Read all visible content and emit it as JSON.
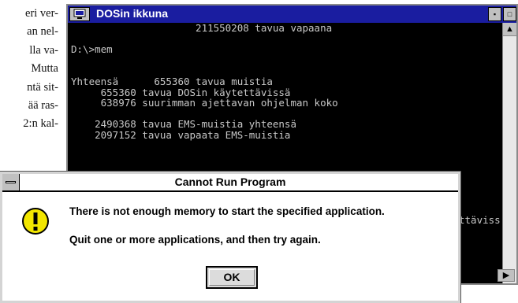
{
  "background_text": {
    "lines": [
      "eri ver-",
      "an nel-",
      "lla va-",
      "Mutta",
      "ntä sit-",
      "ää ras-",
      "2:n kal-"
    ]
  },
  "dos_window": {
    "title": "DOSin ikkuna",
    "console_lines": [
      "                     211550208 tavua vapaana",
      "",
      "D:\\>mem",
      "",
      "",
      "Yhteensä      655360 tavua muistia",
      "     655360 tavua DOSin käytettävissä",
      "     638976 suurimman ajettavan ohjelman koko",
      "",
      "    2490368 tavua EMS-muistia yhteensä",
      "    2097152 tavua vapaata EMS-muistia"
    ],
    "partial_right_text": "ttäviss"
  },
  "dialog": {
    "title": "Cannot Run Program",
    "message_line1": "There is not enough memory to start the specified application.",
    "message_line2": "Quit one or more applications, and then try again.",
    "ok_label": "OK"
  }
}
